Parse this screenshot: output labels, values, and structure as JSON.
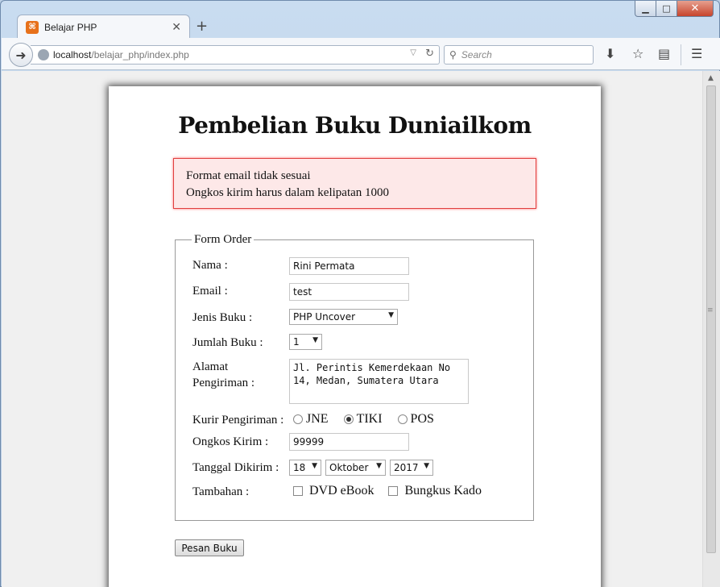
{
  "browser": {
    "tab_title": "Belajar PHP",
    "url_host": "localhost",
    "url_path": "/belajar_php/index.php",
    "search_placeholder": "Search"
  },
  "page": {
    "heading": "Pembelian Buku Duniailkom",
    "errors": [
      "Format email tidak sesuai",
      "Ongkos kirim harus dalam kelipatan 1000"
    ],
    "legend": "Form Order",
    "labels": {
      "nama": "Nama :",
      "email": "Email :",
      "jenis_buku": "Jenis Buku :",
      "jumlah_buku": "Jumlah Buku :",
      "alamat_line1": "Alamat",
      "alamat_line2": "Pengiriman :",
      "kurir": "Kurir Pengiriman :",
      "ongkos": "Ongkos Kirim :",
      "tanggal": "Tanggal Dikirim :",
      "tambahan": "Tambahan :"
    },
    "values": {
      "nama": "Rini Permata",
      "email": "test",
      "jenis_buku": "PHP Uncover",
      "jumlah_buku": "1",
      "alamat": "Jl. Perintis Kemerdekaan No 14, Medan, Sumatera Utara",
      "ongkos": "99999",
      "tanggal_day": "18",
      "tanggal_month": "Oktober",
      "tanggal_year": "2017"
    },
    "kurir_options": [
      {
        "label": "JNE",
        "checked": false
      },
      {
        "label": "TIKI",
        "checked": true
      },
      {
        "label": "POS",
        "checked": false
      }
    ],
    "tambahan_options": [
      {
        "label": "DVD eBook",
        "checked": false
      },
      {
        "label": "Bungkus Kado",
        "checked": false
      }
    ],
    "submit_label": "Pesan Buku"
  },
  "colors": {
    "error_bg": "#fde8e8",
    "error_border": "#e04040",
    "favicon": "#e7711b"
  }
}
